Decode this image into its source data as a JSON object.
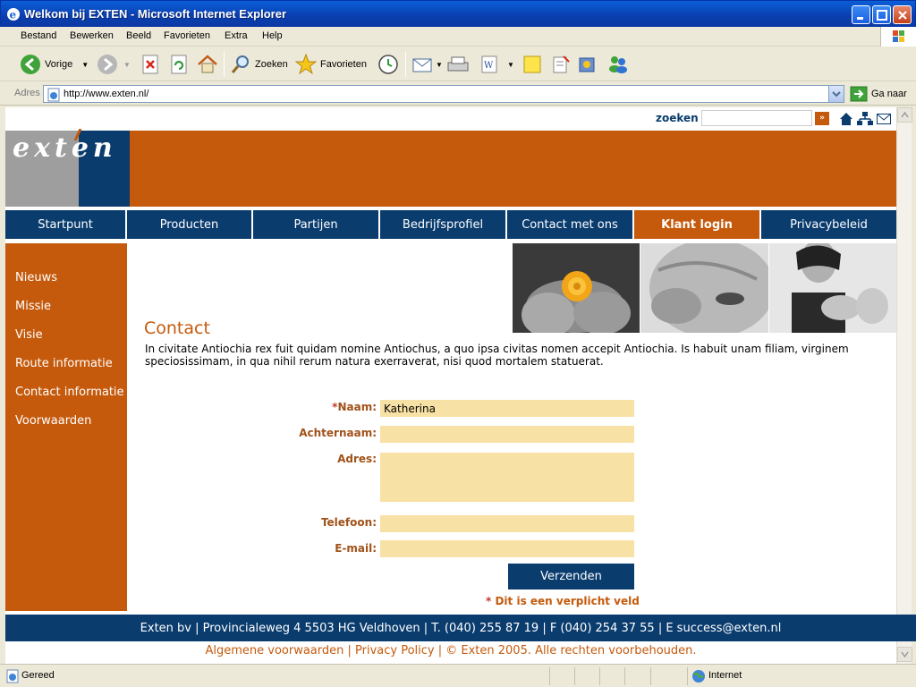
{
  "window": {
    "title": "Welkom bij EXTEN - Microsoft Internet Explorer"
  },
  "menu": [
    "Bestand",
    "Bewerken",
    "Beeld",
    "Favorieten",
    "Extra",
    "Help"
  ],
  "toolbar": {
    "back": "Vorige",
    "search": "Zoeken",
    "favorites": "Favorieten"
  },
  "address": {
    "label": "Adres",
    "url": "http://www.exten.nl/",
    "go": "Ga naar"
  },
  "site": {
    "search_label": "zoeken",
    "search_button": "»",
    "logo_text": "exten",
    "nav": [
      "Startpunt",
      "Producten",
      "Partijen",
      "Bedrijfsprofiel",
      "Contact met ons",
      "Klant login",
      "Privacybeleid"
    ],
    "nav_active": "Klant login",
    "sidebar": [
      "Nieuws",
      "Missie",
      "Visie",
      "Route informatie",
      "Contact informatie",
      "Voorwaarden"
    ],
    "content_title": "Contact",
    "content_text": "In civitate Antiochia rex fuit quidam nomine Antiochus, a quo ipsa civitas nomen accepit Antiochia. Is habuit unam filiam, virginem speciosissimam, in qua nihil rerum natura exerraverat, nisi quod mortalem statuerat.",
    "form": {
      "naam_label": "Naam:",
      "naam_value": "Katherina",
      "achternaam_label": "Achternaam:",
      "adres_label": "Adres:",
      "telefoon_label": "Telefoon:",
      "email_label": "E-mail:",
      "submit": "Verzenden",
      "required_note": "Dit is een verplicht veld"
    },
    "footer_address": "Exten bv | Provincialeweg 4 5503 HG Veldhoven | T. (040) 255 87 19 | F (040) 254 37 55 | E success@exten.nl",
    "footer_links": "Algemene voorwaarden | Privacy Policy | © Exten 2005. Alle rechten voorbehouden."
  },
  "status": {
    "text": "Gereed",
    "zone": "Internet"
  },
  "colors": {
    "orange": "#c55a0c",
    "navy": "#0a3c6e",
    "field": "#f8e1a4"
  }
}
